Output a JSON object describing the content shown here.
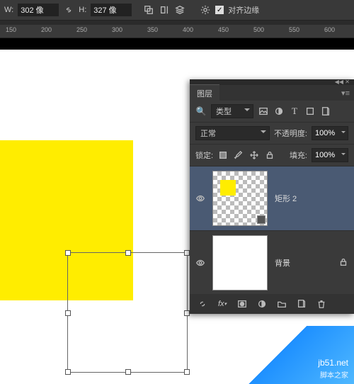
{
  "options": {
    "w_label": "W:",
    "w_value": "302 像",
    "h_label": "H:",
    "h_value": "327 像",
    "align_edges": "对齐边缘"
  },
  "ruler": {
    "t150": "150",
    "t200": "200",
    "t250": "250",
    "t300": "300",
    "t350": "350",
    "t400": "400",
    "t450": "450",
    "t500": "500",
    "t550": "550",
    "t600": "600"
  },
  "panel": {
    "tab": "图层",
    "filter_label": "类型",
    "blend_mode": "正常",
    "opacity_label": "不透明度:",
    "opacity_value": "100%",
    "lock_label": "锁定:",
    "fill_label": "填充:",
    "fill_value": "100%"
  },
  "layers": [
    {
      "name": "矩形 2",
      "selected": true,
      "locked": false
    },
    {
      "name": "背景",
      "selected": false,
      "locked": true
    }
  ],
  "watermark": {
    "site": "jb51.net",
    "sub": "脚本之家"
  }
}
